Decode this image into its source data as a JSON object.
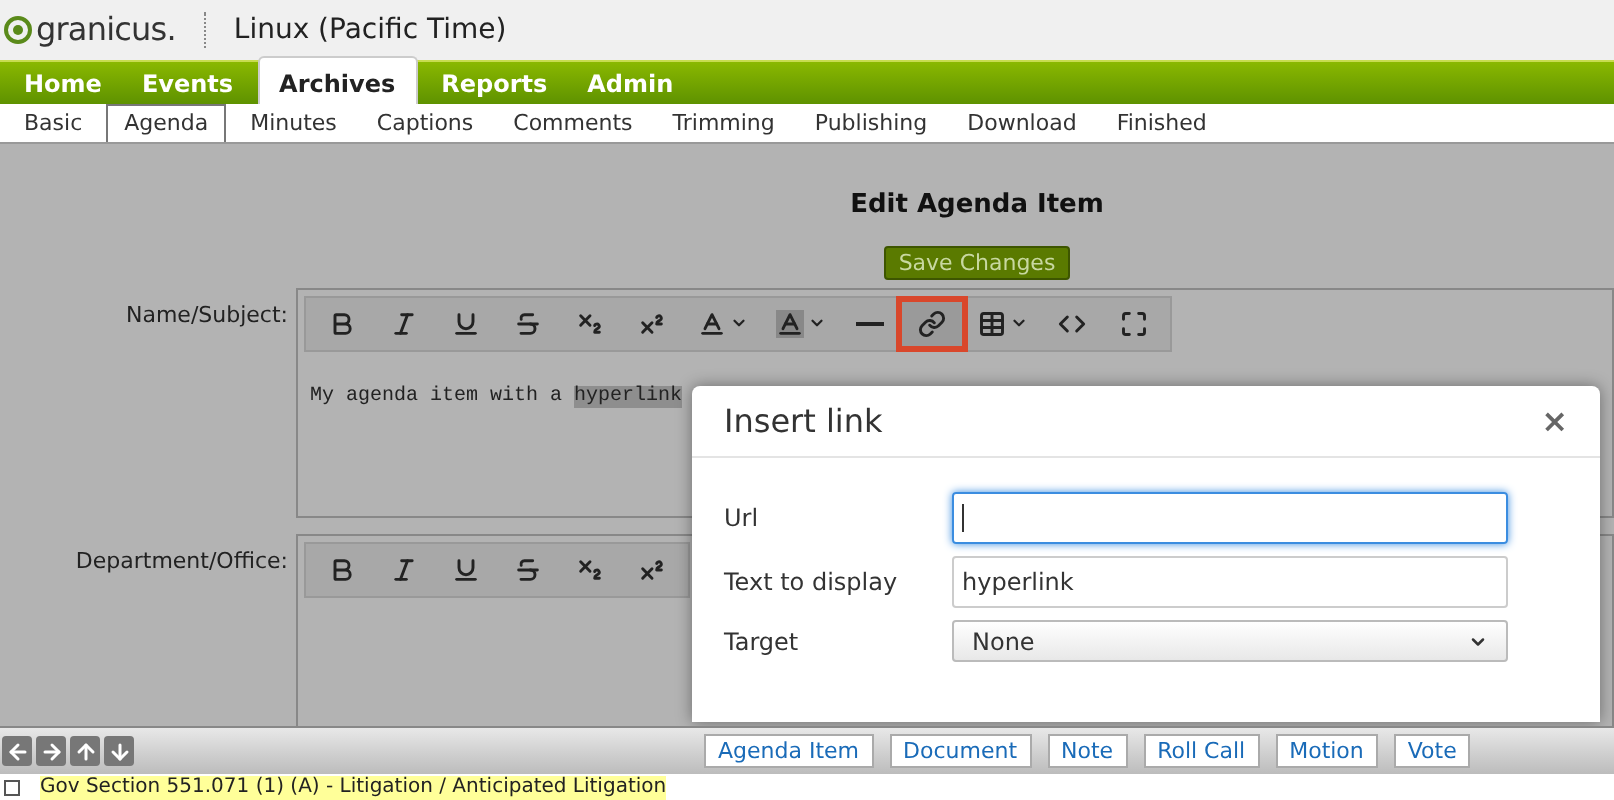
{
  "logo": {
    "text": "granicus."
  },
  "header": {
    "location": "Linux (Pacific Time)"
  },
  "nav": [
    {
      "label": "Home",
      "selected": false
    },
    {
      "label": "Events",
      "selected": false
    },
    {
      "label": "Archives",
      "selected": true
    },
    {
      "label": "Reports",
      "selected": false
    },
    {
      "label": "Admin",
      "selected": false
    }
  ],
  "subnav": [
    {
      "label": "Basic",
      "selected": false
    },
    {
      "label": "Agenda",
      "selected": true
    },
    {
      "label": "Minutes",
      "selected": false
    },
    {
      "label": "Captions",
      "selected": false
    },
    {
      "label": "Comments",
      "selected": false
    },
    {
      "label": "Trimming",
      "selected": false
    },
    {
      "label": "Publishing",
      "selected": false
    },
    {
      "label": "Download",
      "selected": false
    },
    {
      "label": "Finished",
      "selected": false
    }
  ],
  "page_title": "Edit Agenda Item",
  "save_button": "Save Changes",
  "editors": [
    {
      "label": "Name/Subject:",
      "text": "My agenda item with a ",
      "selection": "hyperlink",
      "toolbar": [
        {
          "kind": "bold",
          "active": false
        },
        {
          "kind": "italic",
          "active": false
        },
        {
          "kind": "underline",
          "active": false
        },
        {
          "kind": "strike",
          "active": false
        },
        {
          "kind": "subscript",
          "active": false
        },
        {
          "kind": "superscript",
          "active": false
        },
        {
          "kind": "color",
          "active": false
        },
        {
          "kind": "highlight",
          "active": false
        },
        {
          "kind": "rule",
          "active": false
        },
        {
          "kind": "link",
          "active": true
        },
        {
          "kind": "table",
          "active": false
        },
        {
          "kind": "code",
          "active": false
        },
        {
          "kind": "fullscreen",
          "active": false
        }
      ]
    },
    {
      "label": "Department/Office:",
      "toolbar": [
        {
          "kind": "bold",
          "active": false
        },
        {
          "kind": "italic",
          "active": false
        },
        {
          "kind": "underline",
          "active": false
        },
        {
          "kind": "strike",
          "active": false
        },
        {
          "kind": "subscript",
          "active": false
        },
        {
          "kind": "superscript",
          "active": false
        }
      ]
    }
  ],
  "dialog": {
    "title": "Insert link",
    "close": "×",
    "fields": [
      {
        "label": "Url",
        "kind": "text",
        "focused": true
      },
      {
        "label": "Text to display",
        "kind": "text",
        "value": "hyperlink",
        "focused": false
      },
      {
        "label": "Target",
        "kind": "select",
        "value": "None",
        "focused": false
      }
    ]
  },
  "bottom_buttons": [
    "Agenda Item",
    "Document",
    "Note",
    "Roll Call",
    "Motion",
    "Vote"
  ],
  "footer_item": {
    "checked": false,
    "text": "Gov Section 551.071 (1) (A) - Litigation / Anticipated Litigation"
  }
}
